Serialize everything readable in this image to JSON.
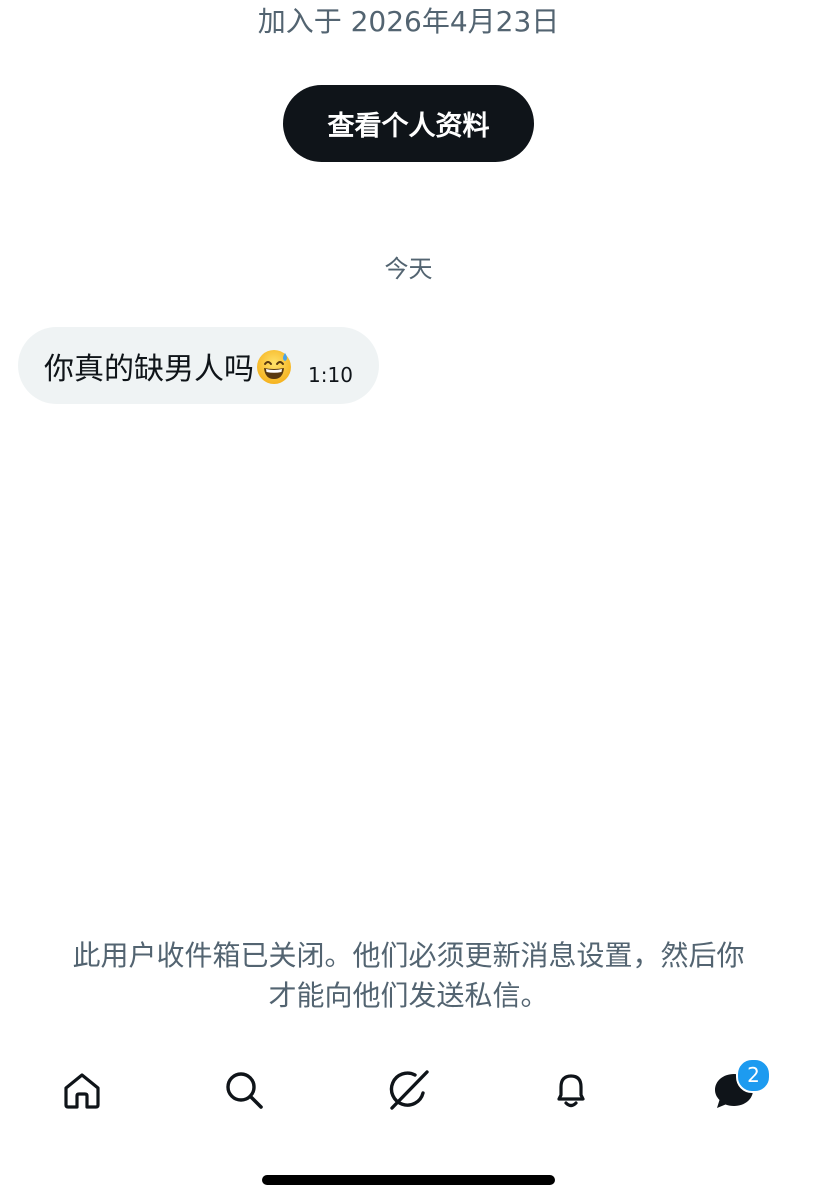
{
  "profile": {
    "joined_text": "加入于 2026年4月23日",
    "view_profile_label": "查看个人资料"
  },
  "conversation": {
    "day_separator": "今天",
    "messages": [
      {
        "text": "你真的缺男人吗",
        "emoji": "grinning-face-with-sweat",
        "time": "1:10"
      }
    ]
  },
  "notice": {
    "line1": "此用户收件箱已关闭。他们必须更新消息设置，然后你",
    "line2": "才能向他们发送私信。"
  },
  "tabbar": {
    "items": [
      {
        "icon": "home-icon"
      },
      {
        "icon": "search-icon"
      },
      {
        "icon": "grok-icon"
      },
      {
        "icon": "bell-icon"
      },
      {
        "icon": "messages-icon",
        "badge": "2"
      }
    ]
  },
  "colors": {
    "primary_text": "#0f1419",
    "secondary_text": "#536471",
    "bubble_bg": "#eff3f4",
    "badge": "#1d9bf0"
  }
}
